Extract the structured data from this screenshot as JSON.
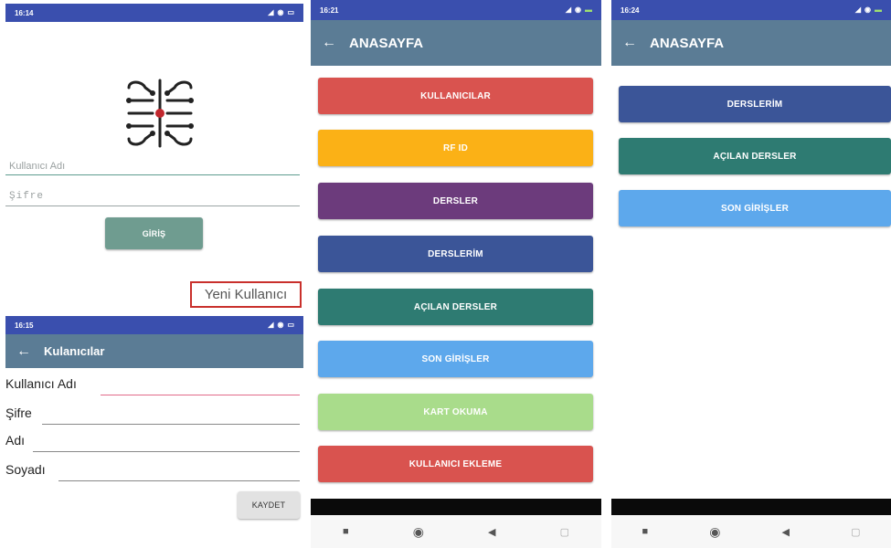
{
  "login": {
    "time": "16:14",
    "username_placeholder": "Kullanıcı Adı",
    "password_placeholder": "Şifre",
    "login_label": "GİRİŞ",
    "new_user_label": "Yeni Kullanıcı"
  },
  "register": {
    "time": "16:15",
    "title": "Kulanıcılar",
    "fields": {
      "username": "Kullanıcı Adı",
      "password": "Şifre",
      "name": "Adı",
      "surname": "Soyadı"
    },
    "save_label": "KAYDET"
  },
  "home_admin": {
    "time": "16:21",
    "title": "ANASAYFA",
    "buttons": [
      {
        "label": "KULLANICILAR",
        "color": "#d9534f"
      },
      {
        "label": "RF ID",
        "color": "#fbb116"
      },
      {
        "label": "DERSLER",
        "color": "#6c3b7c"
      },
      {
        "label": "DERSLERİM",
        "color": "#3b5598"
      },
      {
        "label": "AÇILAN DERSLER",
        "color": "#2e7b72"
      },
      {
        "label": "SON GİRİŞLER",
        "color": "#5da8ec"
      },
      {
        "label": "KART OKUMA",
        "color": "#a9dc8b"
      },
      {
        "label": "KULLANICI EKLEME",
        "color": "#d9534f"
      }
    ]
  },
  "home_user": {
    "time": "16:24",
    "title": "ANASAYFA",
    "buttons": [
      {
        "label": "DERSLERİM",
        "color": "#3b5598"
      },
      {
        "label": "AÇILAN DERSLER",
        "color": "#2e7b72"
      },
      {
        "label": "SON GİRİŞLER",
        "color": "#5da8ec"
      }
    ]
  },
  "icons": [
    "signal-icon",
    "wifi-icon",
    "battery-icon",
    "back-arrow-icon",
    "circuit-logo-icon",
    "nav-square-icon",
    "nav-circle-icon",
    "nav-back-icon",
    "nav-recent-icon"
  ]
}
